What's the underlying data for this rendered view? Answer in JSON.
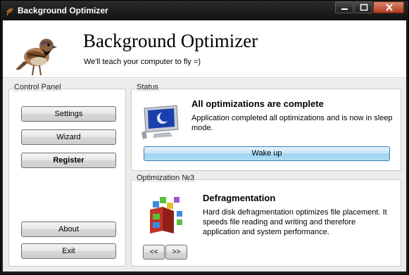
{
  "window": {
    "title": "Background Optimizer"
  },
  "header": {
    "app_name": "Background Optimizer",
    "tagline": "We'll teach your computer to fly =)"
  },
  "control_panel": {
    "title": "Control Panel",
    "buttons": {
      "settings": "Settings",
      "wizard": "Wizard",
      "register": "Register",
      "about": "About",
      "exit": "Exit"
    }
  },
  "status": {
    "title": "Status",
    "heading": "All optimizations are complete",
    "line1": "Application completed all optimizations and is now in sleep",
    "line2": "mode.",
    "wake_button": "Wake up"
  },
  "optimization": {
    "title": "Optimization №3",
    "heading": "Defragmentation",
    "line1": "Hard disk defragmentation optimizes file placement. It",
    "line2": "speeds file reading and writing and therefore",
    "line3": "application and system performance.",
    "prev_button": "<<",
    "next_button": ">>"
  },
  "icons": {
    "app": "sparrow-icon",
    "monitor": "monitor-sleep-icon",
    "defrag": "defrag-blocks-icon"
  },
  "colors": {
    "titlebar": "#1b1b1b",
    "wake_button": "#98d1ef",
    "close_button": "#b33a1e"
  }
}
